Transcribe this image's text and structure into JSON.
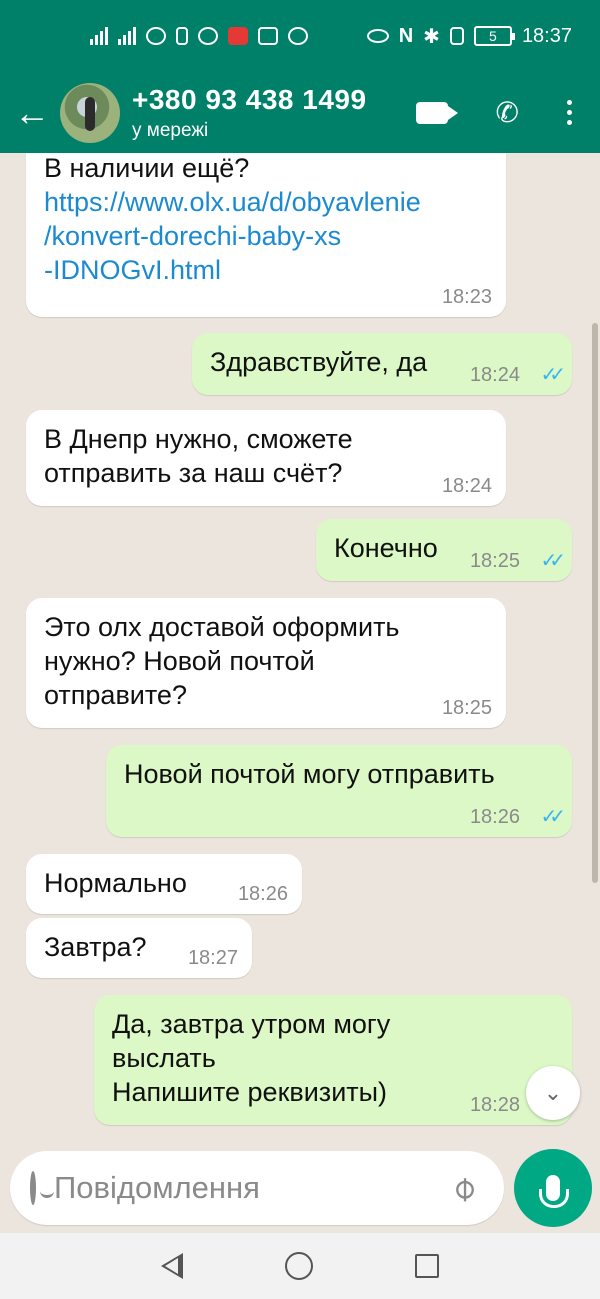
{
  "status_bar": {
    "time": "18:37",
    "battery": "5"
  },
  "header": {
    "back_icon": "arrow-left-icon",
    "contact_name": "+380 93 438 1499",
    "contact_status": "у мережі"
  },
  "messages": [
    {
      "direction": "in",
      "text_lines": [
        "В наличии ещё?"
      ],
      "link_lines": [
        "https://www.olx.ua/d/obyavlenie",
        "/konvert-dorechi-baby-xs",
        "-IDNOGvI.html"
      ],
      "time": "18:23"
    },
    {
      "direction": "out",
      "text": "Здравствуйте, да",
      "time": "18:24",
      "read": true
    },
    {
      "direction": "in",
      "text_lines": [
        "В Днепр нужно, сможете",
        "отправить за наш счёт?"
      ],
      "time": "18:24"
    },
    {
      "direction": "out",
      "text": "Конечно",
      "time": "18:25",
      "read": true
    },
    {
      "direction": "in",
      "text_lines": [
        "Это олх доставой оформить",
        "нужно? Новой почтой",
        "отправите?"
      ],
      "time": "18:25"
    },
    {
      "direction": "out",
      "text": "Новой почтой могу отправить",
      "time": "18:26",
      "read": true
    },
    {
      "direction": "in",
      "text": "Нормально",
      "time": "18:26"
    },
    {
      "direction": "in",
      "text": "Завтра?",
      "time": "18:27"
    },
    {
      "direction": "out",
      "text_lines": [
        "Да, завтра утром могу",
        "выслать",
        "Напишите реквизиты)"
      ],
      "time": "18:28"
    }
  ],
  "input": {
    "placeholder": "Повідомлення"
  },
  "colors": {
    "header": "#008069",
    "outgoing_bubble": "#dcf8c6",
    "incoming_bubble": "#ffffff",
    "read_ticks": "#34b7f1",
    "mic_button": "#00a884",
    "link": "#1b8ad2"
  }
}
